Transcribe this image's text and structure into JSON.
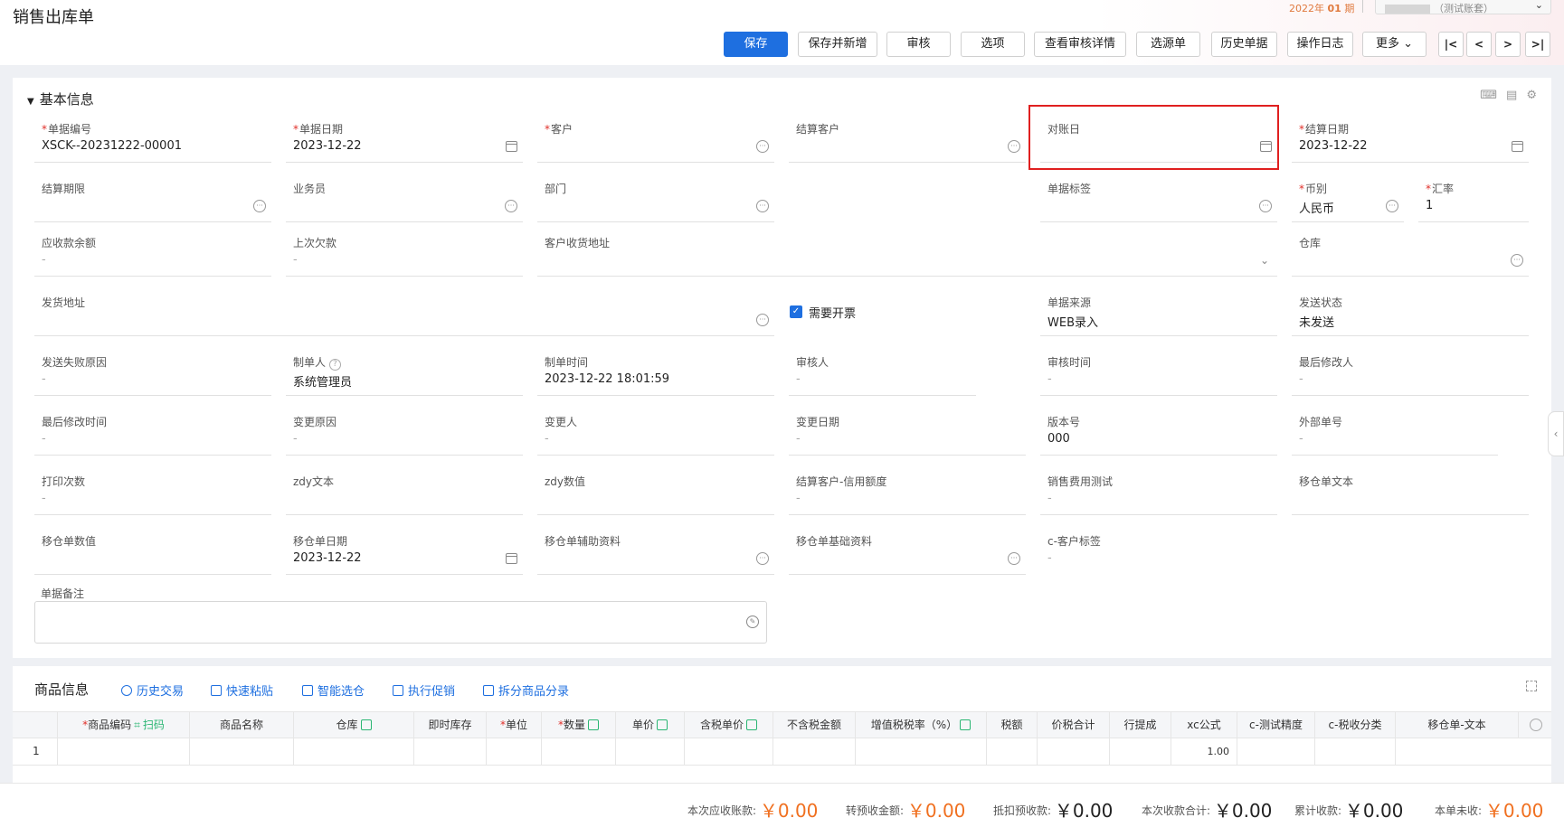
{
  "header": {
    "title": "销售出库单",
    "period_prefix": "2022年",
    "period_value": "01",
    "period_suffix": "期",
    "user_text": "（测试账套）"
  },
  "toolbar": {
    "save": "保存",
    "save_new": "保存并新增",
    "audit": "审核",
    "options": "选项",
    "audit_detail": "查看审核详情",
    "source": "选源单",
    "history": "历史单据",
    "log": "操作日志",
    "more": "更多",
    "first": "|<",
    "prev": "<",
    "next": ">",
    "last": ">|"
  },
  "basic": {
    "title": "基本信息",
    "fields": {
      "bill_no": {
        "label": "单据编号",
        "value": "XSCK--20231222-00001"
      },
      "bill_date": {
        "label": "单据日期",
        "value": "2023-12-22"
      },
      "customer": {
        "label": "客户",
        "value": ""
      },
      "settle_customer": {
        "label": "结算客户",
        "value": ""
      },
      "reconcile_day": {
        "label": "对账日",
        "value": ""
      },
      "settle_date": {
        "label": "结算日期",
        "value": "2023-12-22"
      },
      "settle_term": {
        "label": "结算期限",
        "value": ""
      },
      "salesman": {
        "label": "业务员",
        "value": ""
      },
      "department": {
        "label": "部门",
        "value": ""
      },
      "bill_tag": {
        "label": "单据标签",
        "value": ""
      },
      "currency": {
        "label": "币别",
        "value": "人民币"
      },
      "rate": {
        "label": "汇率",
        "value": "1"
      },
      "receivable": {
        "label": "应收款余额",
        "value": "-"
      },
      "last_debt": {
        "label": "上次欠款",
        "value": "-"
      },
      "cust_address": {
        "label": "客户收货地址",
        "value": ""
      },
      "warehouse": {
        "label": "仓库",
        "value": ""
      },
      "ship_address": {
        "label": "发货地址",
        "value": ""
      },
      "invoice": {
        "label": "需要开票"
      },
      "bill_source": {
        "label": "单据来源",
        "value": "WEB录入"
      },
      "send_status": {
        "label": "发送状态",
        "value": "未发送"
      },
      "send_fail": {
        "label": "发送失败原因",
        "value": "-"
      },
      "creator": {
        "label": "制单人",
        "value": "系统管理员"
      },
      "create_time": {
        "label": "制单时间",
        "value": "2023-12-22 18:01:59"
      },
      "auditor": {
        "label": "审核人",
        "value": "-"
      },
      "audit_time": {
        "label": "审核时间",
        "value": "-"
      },
      "last_modifier": {
        "label": "最后修改人",
        "value": "-"
      },
      "last_modify_time": {
        "label": "最后修改时间",
        "value": "-"
      },
      "change_reason": {
        "label": "变更原因",
        "value": "-"
      },
      "changer": {
        "label": "变更人",
        "value": "-"
      },
      "change_date": {
        "label": "变更日期",
        "value": "-"
      },
      "version": {
        "label": "版本号",
        "value": "000"
      },
      "external_no": {
        "label": "外部单号",
        "value": "-"
      },
      "print_count": {
        "label": "打印次数",
        "value": "-"
      },
      "zdy_text": {
        "label": "zdy文本",
        "value": ""
      },
      "zdy_num": {
        "label": "zdy数值",
        "value": ""
      },
      "credit_limit": {
        "label": "结算客户-信用额度",
        "value": "-"
      },
      "sales_fee": {
        "label": "销售费用测试",
        "value": "-"
      },
      "transfer_text": {
        "label": "移仓单文本",
        "value": ""
      },
      "transfer_num": {
        "label": "移仓单数值",
        "value": ""
      },
      "transfer_date": {
        "label": "移仓单日期",
        "value": "2023-12-22"
      },
      "transfer_aux": {
        "label": "移仓单辅助资料",
        "value": ""
      },
      "transfer_base": {
        "label": "移仓单基础资料",
        "value": ""
      },
      "cust_tag": {
        "label": "c-客户标签",
        "value": "-"
      },
      "remark": {
        "label": "单据备注",
        "value": ""
      }
    }
  },
  "goods": {
    "title": "商品信息",
    "tools": [
      "历史交易",
      "快速粘贴",
      "智能选仓",
      "执行促销",
      "拆分商品分录"
    ],
    "columns": [
      "商品编码",
      "扫码",
      "商品名称",
      "仓库",
      "即时库存",
      "单位",
      "数量",
      "单价",
      "含税单价",
      "不含税金额",
      "增值税税率（%）",
      "税额",
      "价税合计",
      "行提成",
      "xc公式",
      "c-测试精度",
      "c-税收分类",
      "移仓单-文本"
    ],
    "row": {
      "index": "1",
      "xc": "1.00"
    }
  },
  "footer": {
    "items": [
      {
        "label": "本次应收账款:",
        "value": "￥0.00"
      },
      {
        "label": "转预收金额:",
        "value": "￥0.00"
      },
      {
        "label": "抵扣预收款:",
        "value": "￥0.00"
      },
      {
        "label": "本次收款合计:",
        "value": "￥0.00"
      },
      {
        "label": "累计收款:",
        "value": "￥0.00"
      },
      {
        "label": "本单未收:",
        "value": "￥0.00"
      }
    ]
  },
  "colors": {
    "primary": "#1e6fe0",
    "required": "#e0302a",
    "amount_orange": "#f07020",
    "highlight": "#e02020"
  }
}
